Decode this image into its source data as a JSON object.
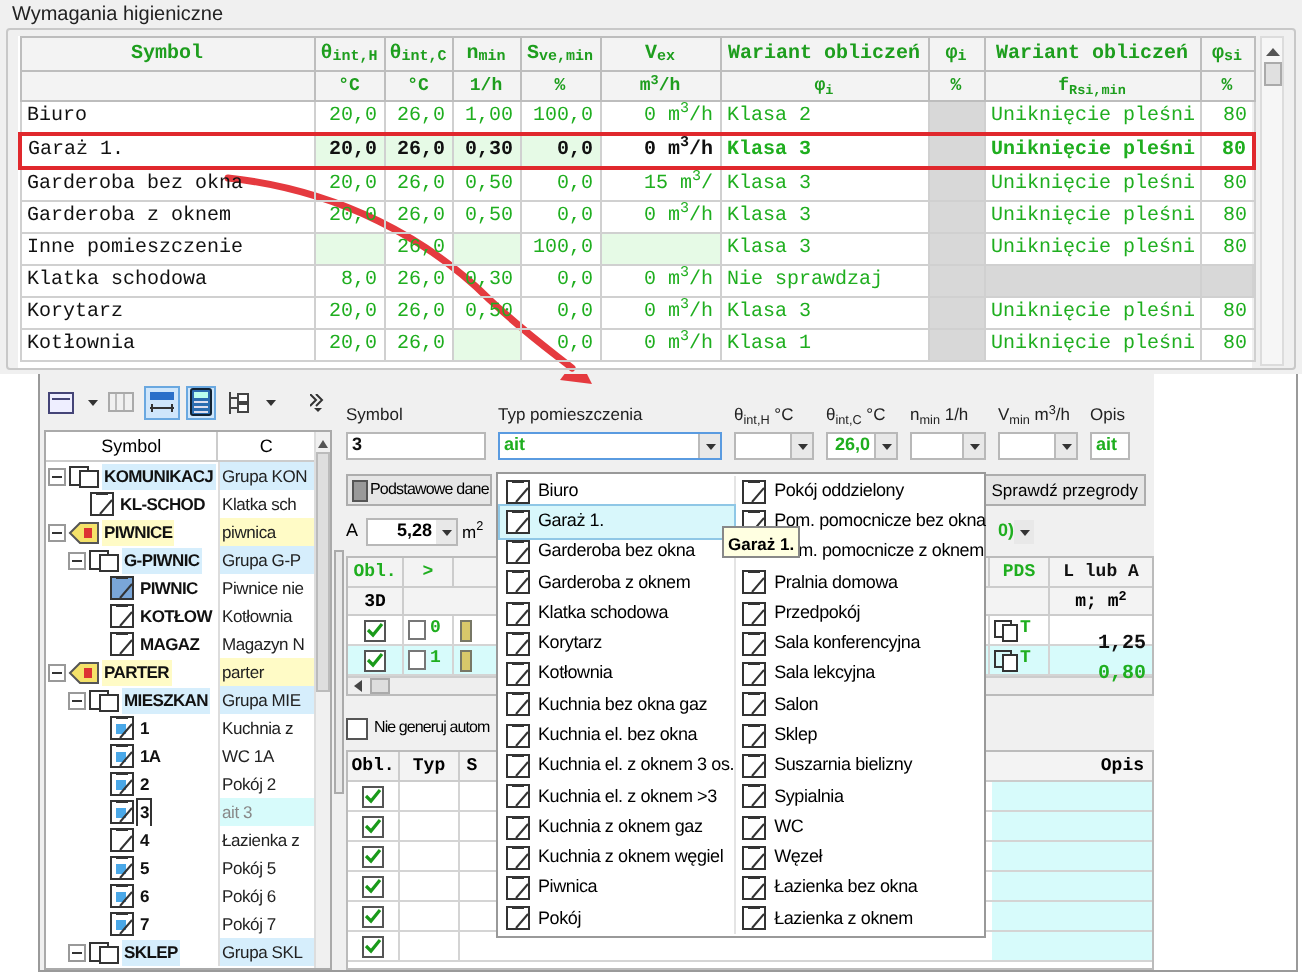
{
  "hygiene_requirements": {
    "title": "Wymagania higieniczne",
    "columns": [
      {
        "header": "Symbol"
      },
      {
        "header": "θ$_{int,H}$",
        "unit": "°C"
      },
      {
        "header": "θ$_{int,C}$",
        "unit": "°C"
      },
      {
        "header": "n$_{min}$",
        "unit": "1/h"
      },
      {
        "header": "S$_{ve,min}$",
        "unit": "%"
      },
      {
        "header": "V$_{ex}$",
        "unit": "m$^{3}$/h"
      },
      {
        "header": "Wariant obliczeń",
        "unit": "φ$_{i}$"
      },
      {
        "header": "φ$_{i}$",
        "unit": "%"
      },
      {
        "header": "Wariant obliczeń",
        "unit": "f$_{Rsi,min}$"
      },
      {
        "header": "φ$_{si}$",
        "unit": "%"
      }
    ],
    "rows": [
      {
        "selected": false,
        "cells": [
          "Biuro",
          "20,0",
          "26,0",
          "1,00",
          "100,0",
          "0 m$^{3}$/h",
          "Klasa 2",
          null,
          "Uniknięcie pleśni",
          "80"
        ]
      },
      {
        "selected": true,
        "cells": [
          "Garaż 1.",
          "20,0",
          "26,0",
          "0,30",
          "0,0",
          "0 m$^{3}$/h",
          "Klasa 3",
          null,
          "Uniknięcie pleśni",
          "80"
        ]
      },
      {
        "selected": false,
        "cells": [
          "Garderoba bez okna",
          "20,0",
          "26,0",
          "0,50",
          "0,0",
          "15 m$^{3}$/",
          "Klasa 3",
          null,
          "Uniknięcie pleśni",
          "80"
        ]
      },
      {
        "selected": false,
        "cells": [
          "Garderoba z oknem",
          "20,0",
          "26,0",
          "0,50",
          "0,0",
          "0 m$^{3}$/h",
          "Klasa 3",
          null,
          "Uniknięcie pleśni",
          "80"
        ]
      },
      {
        "selected": false,
        "cells": [
          "Inne pomieszczenie",
          null,
          "26,0",
          null,
          "100,0",
          null,
          "Klasa 3",
          null,
          "Uniknięcie pleśni",
          "80"
        ]
      },
      {
        "selected": false,
        "cells": [
          "Klatka schodowa",
          "8,0",
          "26,0",
          "0,30",
          "0,0",
          "0 m$^{3}$/h",
          "Nie sprawdzaj",
          null,
          null,
          null
        ]
      },
      {
        "selected": false,
        "cells": [
          "Korytarz",
          "20,0",
          "26,0",
          "0,50",
          "0,0",
          "0 m$^{3}$/h",
          "Klasa 3",
          null,
          "Uniknięcie pleśni",
          "80"
        ]
      },
      {
        "selected": false,
        "cells": [
          "Kotłownia",
          "20,0",
          "26,0",
          null,
          "0,0",
          "0 m$^{3}$/h",
          "Klasa 1",
          null,
          "Uniknięcie pleśni",
          "80"
        ]
      }
    ]
  },
  "toolbar": [
    {
      "kind": "view",
      "selected": false
    },
    {
      "kind": "grid",
      "selected": false
    },
    {
      "kind": "auto",
      "selected": true
    },
    {
      "kind": "calc",
      "selected": true
    },
    {
      "kind": "tree",
      "selected": false
    }
  ],
  "tree": {
    "columns": [
      "Symbol",
      "C"
    ],
    "items": [
      {
        "kind": "group",
        "symbol": "KOMUNIKACJ",
        "name": "Grupa KON",
        "expanded": true,
        "selected": false,
        "children": [
          {
            "kind": "room",
            "symbol": "KL-SCHOD",
            "name": "Klatka sch",
            "selected": false
          }
        ]
      },
      {
        "kind": "floor",
        "symbol": "PIWNICE",
        "name": "piwnica",
        "expanded": true,
        "selected": false,
        "children": [
          {
            "kind": "group",
            "symbol": "G-PIWNIC",
            "name": "Grupa G-P",
            "expanded": true,
            "selected": false,
            "children": [
              {
                "kind": "room_filled",
                "symbol": "PIWNIC",
                "name": "Piwnice nie",
                "selected": false
              },
              {
                "kind": "room",
                "symbol": "KOTŁOW",
                "name": "Kotłownia",
                "selected": false
              },
              {
                "kind": "room",
                "symbol": "MAGAZ",
                "name": "Magazyn N",
                "selected": false
              }
            ]
          }
        ]
      },
      {
        "kind": "floor",
        "symbol": "PARTER",
        "name": "parter",
        "expanded": true,
        "selected": false,
        "children": [
          {
            "kind": "group",
            "symbol": "MIESZKAN",
            "name": "Grupa MIE",
            "expanded": true,
            "selected": false,
            "children": [
              {
                "kind": "room_heated",
                "symbol": "1",
                "name": "Kuchnia z",
                "selected": false
              },
              {
                "kind": "room_heated",
                "symbol": "1A",
                "name": "WC 1A",
                "selected": false
              },
              {
                "kind": "room_heated",
                "symbol": "2",
                "name": "Pokój 2",
                "selected": false
              },
              {
                "kind": "room_heated",
                "symbol": "3",
                "name": "ait 3",
                "selected": true
              },
              {
                "kind": "room",
                "symbol": "4",
                "name": "Łazienka z",
                "selected": false
              },
              {
                "kind": "room_heated",
                "symbol": "5",
                "name": "Pokój 5",
                "selected": false
              },
              {
                "kind": "room_heated",
                "symbol": "6",
                "name": "Pokój 6",
                "selected": false
              },
              {
                "kind": "room_heated",
                "symbol": "7",
                "name": "Pokój 7",
                "selected": false
              }
            ]
          },
          {
            "kind": "group",
            "symbol": "SKLEP",
            "name": "Grupa SKL",
            "expanded": true,
            "selected": false
          }
        ]
      }
    ]
  },
  "form": {
    "fields": [
      {
        "label": "Symbol",
        "value": "3"
      },
      {
        "label": "Typ pomieszczenia",
        "value": "ait"
      },
      {
        "label": "θ$_{int,H}$ °C"
      },
      {
        "label": "θ$_{int,C}$ °C",
        "value": "26,0"
      },
      {
        "label": "n$_{min}$ 1/h"
      },
      {
        "label": "V$_{min}$ m$^{3}$/h"
      },
      {
        "label": "Opis",
        "value": "ait"
      }
    ],
    "buttons": [
      "Podstawowe dane",
      "Sprawdź przegrody"
    ],
    "area_label": "A",
    "area_value": "5,28",
    "area_unit": "m$^{2}$",
    "right_value": "0)"
  },
  "partitions": {
    "columns": [
      "Obl.",
      ">",
      "PDS",
      "L lub A"
    ],
    "units": [
      "3D",
      "m; m$^{2}$"
    ],
    "rows": [
      {
        "checked": true,
        "number": "0",
        "type": "T",
        "value": "1,25",
        "selected": false
      },
      {
        "checked": true,
        "number": "1",
        "type": "T",
        "value": "0,80",
        "selected": true
      }
    ]
  },
  "auto_generate": {
    "label": "Nie generuj autom",
    "checked": false
  },
  "elements": {
    "columns": [
      "Obl.",
      "Typ",
      "S",
      "Opis"
    ],
    "rows": [
      {
        "checked": true
      },
      {
        "checked": true
      },
      {
        "checked": true
      },
      {
        "checked": true
      },
      {
        "checked": true
      },
      {
        "checked": true
      }
    ]
  },
  "dropdown": {
    "columns": [
      [
        {
          "label": "Biuro",
          "selected": false
        },
        {
          "label": "Garaż 1.",
          "selected": true
        },
        {
          "label": "Garderoba bez okna",
          "selected": false
        },
        {
          "label": "Garderoba z oknem",
          "selected": false
        },
        {
          "label": "Klatka schodowa",
          "selected": false
        },
        {
          "label": "Korytarz",
          "selected": false
        },
        {
          "label": "Kotłownia",
          "selected": false
        },
        {
          "label": "Kuchnia bez okna gaz",
          "selected": false
        },
        {
          "label": "Kuchnia el. bez okna",
          "selected": false
        },
        {
          "label": "Kuchnia el. z oknem 3 os.",
          "selected": false
        },
        {
          "label": "Kuchnia el. z oknem >3",
          "selected": false
        },
        {
          "label": "Kuchnia z oknem gaz",
          "selected": false
        },
        {
          "label": "Kuchnia z oknem węgiel",
          "selected": false
        },
        {
          "label": "Piwnica",
          "selected": false
        },
        {
          "label": "Pokój",
          "selected": false
        }
      ],
      [
        {
          "label": "Pokój oddzielony",
          "selected": false
        },
        {
          "label": "Pom. pomocnicze bez okna",
          "selected": false
        },
        {
          "label": "m. pomocnicze z oknem",
          "selected": false,
          "covered": true
        },
        {
          "label": "Pralnia domowa",
          "selected": false
        },
        {
          "label": "Przedpokój",
          "selected": false
        },
        {
          "label": "Sala konferencyjna",
          "selected": false
        },
        {
          "label": "Sala lekcyjna",
          "selected": false
        },
        {
          "label": "Salon",
          "selected": false
        },
        {
          "label": "Sklep",
          "selected": false
        },
        {
          "label": "Suszarnia bielizny",
          "selected": false
        },
        {
          "label": "Sypialnia",
          "selected": false
        },
        {
          "label": "WC",
          "selected": false
        },
        {
          "label": "Węzeł",
          "selected": false
        },
        {
          "label": "Łazienka bez okna",
          "selected": false
        },
        {
          "label": "Łazienka z oknem",
          "selected": false
        }
      ]
    ],
    "tooltip": "Garaż 1."
  }
}
